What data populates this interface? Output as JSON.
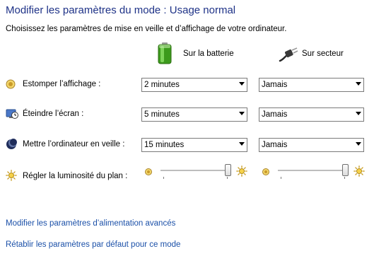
{
  "header": {
    "title": "Modifier les paramètres du mode : Usage normal",
    "subtitle": "Choisissez les paramètres de mise en veille et d’affichage de votre ordinateur."
  },
  "columns": {
    "battery": {
      "label": "Sur la batterie",
      "icon": "battery-icon"
    },
    "plugged": {
      "label": "Sur secteur",
      "icon": "power-plug-icon"
    }
  },
  "rows": [
    {
      "label": "Estomper l’affichage :",
      "icon": "dim-display-icon",
      "battery_value": "2 minutes",
      "plugged_value": "Jamais"
    },
    {
      "label": "Éteindre l’écran :",
      "icon": "monitor-clock-icon",
      "battery_value": "5 minutes",
      "plugged_value": "Jamais"
    },
    {
      "label": "Mettre l’ordinateur en veille :",
      "icon": "sleep-moon-icon",
      "battery_value": "15 minutes",
      "plugged_value": "Jamais"
    }
  ],
  "brightness": {
    "label": "Régler la luminosité du plan :",
    "icon": "brightness-sun-icon",
    "battery_level": 1.0,
    "plugged_level": 1.0
  },
  "links": {
    "advanced": "Modifier les paramètres d’alimentation avancés",
    "restore": "Rétablir les paramètres par défaut pour ce mode"
  }
}
